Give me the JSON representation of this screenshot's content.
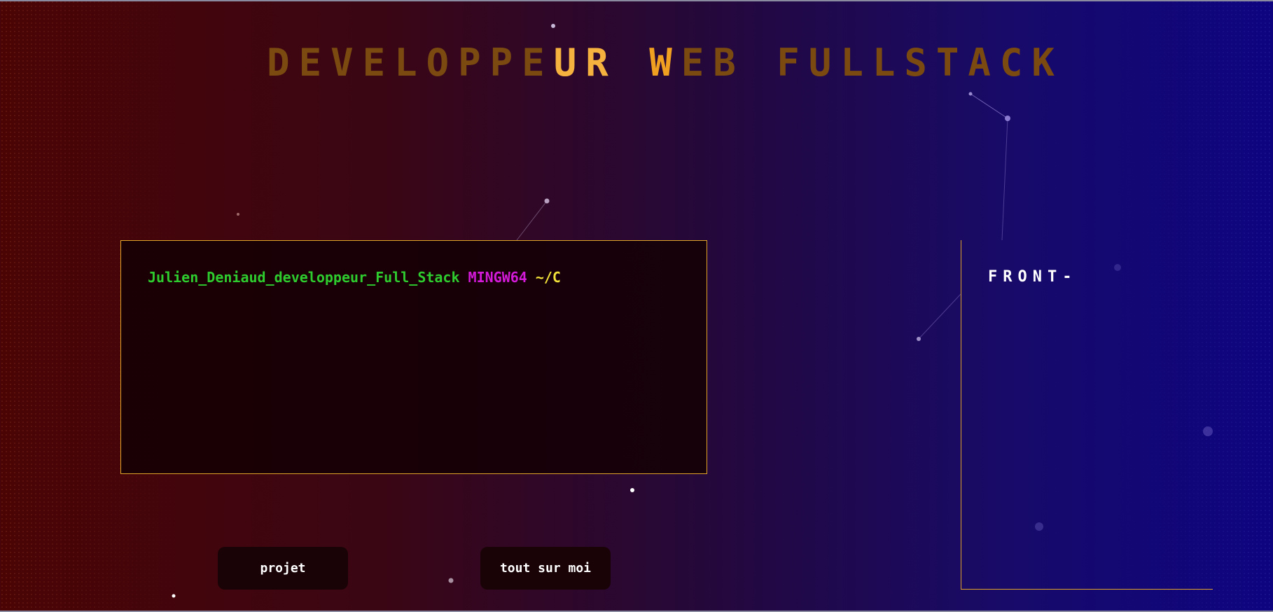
{
  "header": {
    "title_part1": "DEVELOPPE",
    "title_part2": "UR",
    "title_part3": " W",
    "title_part4": "EB FULLSTACK"
  },
  "terminal": {
    "user": "Julien_Deniaud_developpeur_Full_Stack",
    "system": "MINGW64",
    "path": "~/C"
  },
  "front_panel": {
    "title": "FRONT-"
  },
  "nav": {
    "projet_label": "projet",
    "about_label": "tout sur moi"
  },
  "colors": {
    "accent": "#e0a428",
    "title_lit": "#f6b23e",
    "title_dim": "#7a4a10",
    "prompt_user": "#2ecc2e",
    "prompt_system": "#d21ad8",
    "prompt_path": "#f2e23a"
  }
}
